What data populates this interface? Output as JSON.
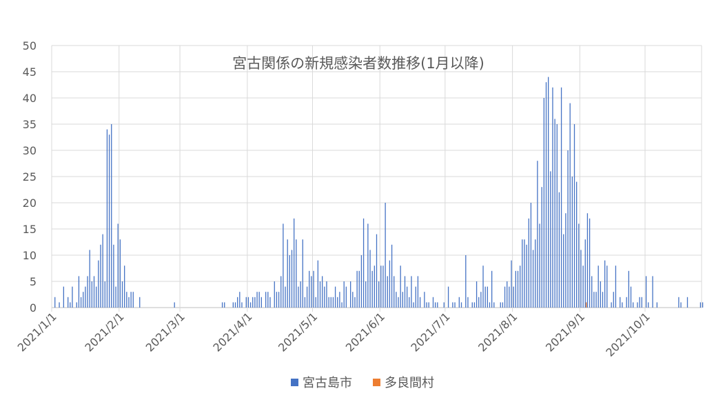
{
  "chart_data": {
    "type": "bar",
    "title": "宮古関係の新規感染者数推移(1月以降)",
    "x_start": "2021-01-01",
    "x_end": "2021-10-26",
    "ylim": [
      0,
      50
    ],
    "y_ticks": [
      0,
      5,
      10,
      15,
      20,
      25,
      30,
      35,
      40,
      45,
      50
    ],
    "x_ticks": [
      "2021/1/1",
      "2021/2/1",
      "2021/3/1",
      "2021/4/1",
      "2021/5/1",
      "2021/6/1",
      "2021/7/1",
      "2021/8/1",
      "2021/9/1",
      "2021/10/1"
    ],
    "grid": true,
    "legend_position": "bottom",
    "series": [
      {
        "name": "宮古島市",
        "color": "#4472c4",
        "points": [
          [
            "2021-01-02",
            2
          ],
          [
            "2021-01-04",
            1
          ],
          [
            "2021-01-06",
            4
          ],
          [
            "2021-01-08",
            2
          ],
          [
            "2021-01-09",
            1
          ],
          [
            "2021-01-10",
            4
          ],
          [
            "2021-01-12",
            1
          ],
          [
            "2021-01-13",
            6
          ],
          [
            "2021-01-14",
            2
          ],
          [
            "2021-01-15",
            3
          ],
          [
            "2021-01-16",
            4
          ],
          [
            "2021-01-17",
            6
          ],
          [
            "2021-01-18",
            11
          ],
          [
            "2021-01-19",
            5
          ],
          [
            "2021-01-20",
            6
          ],
          [
            "2021-01-21",
            4
          ],
          [
            "2021-01-22",
            9
          ],
          [
            "2021-01-23",
            12
          ],
          [
            "2021-01-24",
            14
          ],
          [
            "2021-01-25",
            5
          ],
          [
            "2021-01-26",
            34
          ],
          [
            "2021-01-27",
            33
          ],
          [
            "2021-01-28",
            35
          ],
          [
            "2021-01-29",
            12
          ],
          [
            "2021-01-30",
            4
          ],
          [
            "2021-01-31",
            16
          ],
          [
            "2021-02-01",
            13
          ],
          [
            "2021-02-02",
            5
          ],
          [
            "2021-02-03",
            8
          ],
          [
            "2021-02-04",
            3
          ],
          [
            "2021-02-05",
            2
          ],
          [
            "2021-02-06",
            3
          ],
          [
            "2021-02-07",
            3
          ],
          [
            "2021-02-10",
            2
          ],
          [
            "2021-02-26",
            1
          ],
          [
            "2021-03-20",
            1
          ],
          [
            "2021-03-21",
            1
          ],
          [
            "2021-03-25",
            1
          ],
          [
            "2021-03-26",
            1
          ],
          [
            "2021-03-27",
            2
          ],
          [
            "2021-03-28",
            3
          ],
          [
            "2021-03-29",
            1
          ],
          [
            "2021-03-31",
            2
          ],
          [
            "2021-04-01",
            2
          ],
          [
            "2021-04-02",
            1
          ],
          [
            "2021-04-03",
            2
          ],
          [
            "2021-04-04",
            2
          ],
          [
            "2021-04-05",
            3
          ],
          [
            "2021-04-06",
            3
          ],
          [
            "2021-04-07",
            2
          ],
          [
            "2021-04-09",
            3
          ],
          [
            "2021-04-10",
            3
          ],
          [
            "2021-04-11",
            2
          ],
          [
            "2021-04-13",
            5
          ],
          [
            "2021-04-14",
            3
          ],
          [
            "2021-04-15",
            3
          ],
          [
            "2021-04-16",
            6
          ],
          [
            "2021-04-17",
            16
          ],
          [
            "2021-04-18",
            4
          ],
          [
            "2021-04-19",
            13
          ],
          [
            "2021-04-20",
            10
          ],
          [
            "2021-04-21",
            11
          ],
          [
            "2021-04-22",
            17
          ],
          [
            "2021-04-23",
            13
          ],
          [
            "2021-04-24",
            4
          ],
          [
            "2021-04-25",
            5
          ],
          [
            "2021-04-26",
            13
          ],
          [
            "2021-04-27",
            2
          ],
          [
            "2021-04-28",
            4
          ],
          [
            "2021-04-29",
            7
          ],
          [
            "2021-04-30",
            6
          ],
          [
            "2021-05-01",
            7
          ],
          [
            "2021-05-02",
            2
          ],
          [
            "2021-05-03",
            9
          ],
          [
            "2021-05-04",
            5
          ],
          [
            "2021-05-05",
            6
          ],
          [
            "2021-05-06",
            4
          ],
          [
            "2021-05-07",
            5
          ],
          [
            "2021-05-08",
            2
          ],
          [
            "2021-05-09",
            2
          ],
          [
            "2021-05-10",
            2
          ],
          [
            "2021-05-11",
            4
          ],
          [
            "2021-05-12",
            2
          ],
          [
            "2021-05-13",
            3
          ],
          [
            "2021-05-14",
            1
          ],
          [
            "2021-05-15",
            5
          ],
          [
            "2021-05-16",
            4
          ],
          [
            "2021-05-18",
            5
          ],
          [
            "2021-05-19",
            3
          ],
          [
            "2021-05-20",
            2
          ],
          [
            "2021-05-21",
            7
          ],
          [
            "2021-05-22",
            7
          ],
          [
            "2021-05-23",
            10
          ],
          [
            "2021-05-24",
            17
          ],
          [
            "2021-05-25",
            5
          ],
          [
            "2021-05-26",
            16
          ],
          [
            "2021-05-27",
            11
          ],
          [
            "2021-05-28",
            7
          ],
          [
            "2021-05-29",
            8
          ],
          [
            "2021-05-30",
            14
          ],
          [
            "2021-05-31",
            5
          ],
          [
            "2021-06-01",
            8
          ],
          [
            "2021-06-02",
            8
          ],
          [
            "2021-06-03",
            20
          ],
          [
            "2021-06-04",
            6
          ],
          [
            "2021-06-05",
            9
          ],
          [
            "2021-06-06",
            12
          ],
          [
            "2021-06-07",
            6
          ],
          [
            "2021-06-08",
            3
          ],
          [
            "2021-06-09",
            2
          ],
          [
            "2021-06-10",
            8
          ],
          [
            "2021-06-11",
            3
          ],
          [
            "2021-06-12",
            6
          ],
          [
            "2021-06-13",
            4
          ],
          [
            "2021-06-14",
            2
          ],
          [
            "2021-06-15",
            6
          ],
          [
            "2021-06-16",
            1
          ],
          [
            "2021-06-17",
            4
          ],
          [
            "2021-06-18",
            6
          ],
          [
            "2021-06-19",
            2
          ],
          [
            "2021-06-21",
            3
          ],
          [
            "2021-06-22",
            1
          ],
          [
            "2021-06-23",
            1
          ],
          [
            "2021-06-25",
            2
          ],
          [
            "2021-06-26",
            1
          ],
          [
            "2021-06-27",
            1
          ],
          [
            "2021-06-30",
            1
          ],
          [
            "2021-07-02",
            4
          ],
          [
            "2021-07-04",
            1
          ],
          [
            "2021-07-05",
            1
          ],
          [
            "2021-07-07",
            2
          ],
          [
            "2021-07-08",
            1
          ],
          [
            "2021-07-10",
            10
          ],
          [
            "2021-07-11",
            2
          ],
          [
            "2021-07-13",
            1
          ],
          [
            "2021-07-14",
            1
          ],
          [
            "2021-07-15",
            5
          ],
          [
            "2021-07-16",
            2
          ],
          [
            "2021-07-17",
            3
          ],
          [
            "2021-07-18",
            8
          ],
          [
            "2021-07-19",
            4
          ],
          [
            "2021-07-20",
            4
          ],
          [
            "2021-07-21",
            1
          ],
          [
            "2021-07-22",
            7
          ],
          [
            "2021-07-23",
            1
          ],
          [
            "2021-07-26",
            1
          ],
          [
            "2021-07-27",
            1
          ],
          [
            "2021-07-28",
            4
          ],
          [
            "2021-07-29",
            5
          ],
          [
            "2021-07-30",
            4
          ],
          [
            "2021-07-31",
            9
          ],
          [
            "2021-08-01",
            4
          ],
          [
            "2021-08-02",
            7
          ],
          [
            "2021-08-03",
            7
          ],
          [
            "2021-08-04",
            8
          ],
          [
            "2021-08-05",
            13
          ],
          [
            "2021-08-06",
            13
          ],
          [
            "2021-08-07",
            12
          ],
          [
            "2021-08-08",
            17
          ],
          [
            "2021-08-09",
            20
          ],
          [
            "2021-08-10",
            11
          ],
          [
            "2021-08-11",
            13
          ],
          [
            "2021-08-12",
            28
          ],
          [
            "2021-08-13",
            16
          ],
          [
            "2021-08-14",
            23
          ],
          [
            "2021-08-15",
            40
          ],
          [
            "2021-08-16",
            43
          ],
          [
            "2021-08-17",
            44
          ],
          [
            "2021-08-18",
            26
          ],
          [
            "2021-08-19",
            42
          ],
          [
            "2021-08-20",
            36
          ],
          [
            "2021-08-21",
            35
          ],
          [
            "2021-08-22",
            22
          ],
          [
            "2021-08-23",
            42
          ],
          [
            "2021-08-24",
            14
          ],
          [
            "2021-08-25",
            18
          ],
          [
            "2021-08-26",
            30
          ],
          [
            "2021-08-27",
            39
          ],
          [
            "2021-08-28",
            25
          ],
          [
            "2021-08-29",
            35
          ],
          [
            "2021-08-30",
            24
          ],
          [
            "2021-08-31",
            16
          ],
          [
            "2021-09-01",
            11
          ],
          [
            "2021-09-02",
            8
          ],
          [
            "2021-09-03",
            13
          ],
          [
            "2021-09-04",
            18
          ],
          [
            "2021-09-05",
            17
          ],
          [
            "2021-09-06",
            6
          ],
          [
            "2021-09-07",
            3
          ],
          [
            "2021-09-08",
            3
          ],
          [
            "2021-09-09",
            8
          ],
          [
            "2021-09-10",
            5
          ],
          [
            "2021-09-11",
            3
          ],
          [
            "2021-09-12",
            9
          ],
          [
            "2021-09-13",
            8
          ],
          [
            "2021-09-15",
            1
          ],
          [
            "2021-09-16",
            3
          ],
          [
            "2021-09-17",
            8
          ],
          [
            "2021-09-19",
            2
          ],
          [
            "2021-09-20",
            1
          ],
          [
            "2021-09-22",
            2
          ],
          [
            "2021-09-23",
            7
          ],
          [
            "2021-09-24",
            4
          ],
          [
            "2021-09-25",
            1
          ],
          [
            "2021-09-27",
            1
          ],
          [
            "2021-09-28",
            2
          ],
          [
            "2021-09-29",
            2
          ],
          [
            "2021-10-01",
            6
          ],
          [
            "2021-10-02",
            1
          ],
          [
            "2021-10-04",
            6
          ],
          [
            "2021-10-06",
            1
          ],
          [
            "2021-10-16",
            2
          ],
          [
            "2021-10-17",
            1
          ],
          [
            "2021-10-20",
            2
          ],
          [
            "2021-10-26",
            1
          ],
          [
            "2021-10-27",
            1
          ]
        ]
      },
      {
        "name": "多良間村",
        "color": "#ed7d31",
        "points": [
          [
            "2021-09-03",
            1
          ]
        ]
      }
    ]
  }
}
